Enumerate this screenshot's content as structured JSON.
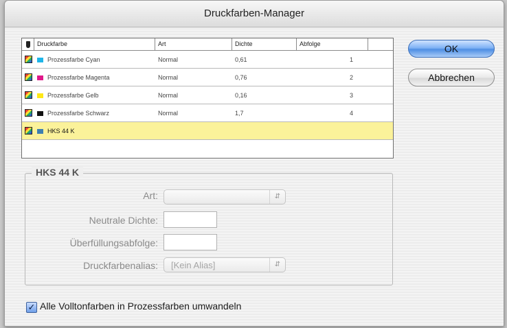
{
  "window": {
    "title": "Druckfarben-Manager"
  },
  "table": {
    "headers": [
      "Druckfarbe",
      "Art",
      "Dichte",
      "Abfolge"
    ],
    "rows": [
      {
        "name": "Prozessfarbe Cyan",
        "art": "Normal",
        "dichte": "0,61",
        "abfolge": "1",
        "color": "#1fb5e8",
        "selected": false
      },
      {
        "name": "Prozessfarbe Magenta",
        "art": "Normal",
        "dichte": "0,76",
        "abfolge": "2",
        "color": "#e0198a",
        "selected": false
      },
      {
        "name": "Prozessfarbe Gelb",
        "art": "Normal",
        "dichte": "0,16",
        "abfolge": "3",
        "color": "#ffe817",
        "selected": false
      },
      {
        "name": "Prozessfarbe Schwarz",
        "art": "Normal",
        "dichte": "1,7",
        "abfolge": "4",
        "color": "#111111",
        "selected": false
      },
      {
        "name": "HKS 44 K",
        "art": "",
        "dichte": "",
        "abfolge": "",
        "color": "#3d7fb0",
        "selected": true
      }
    ]
  },
  "details": {
    "group_title": "HKS 44 K",
    "art_label": "Art:",
    "art_value": "",
    "dichte_label": "Neutrale Dichte:",
    "dichte_value": "",
    "abfolge_label": "Überfüllungsabfolge:",
    "abfolge_value": "",
    "alias_label": "Druckfarbenalias:",
    "alias_value": "[Kein Alias]"
  },
  "buttons": {
    "ok": "OK",
    "cancel": "Abbrechen"
  },
  "option": {
    "convert_label": "Alle Volltonfarben in Prozessfarben umwandeln",
    "checked": true
  },
  "colors": {
    "selected_row": "#fbf29a",
    "ok_button": "#6aa3ee"
  }
}
